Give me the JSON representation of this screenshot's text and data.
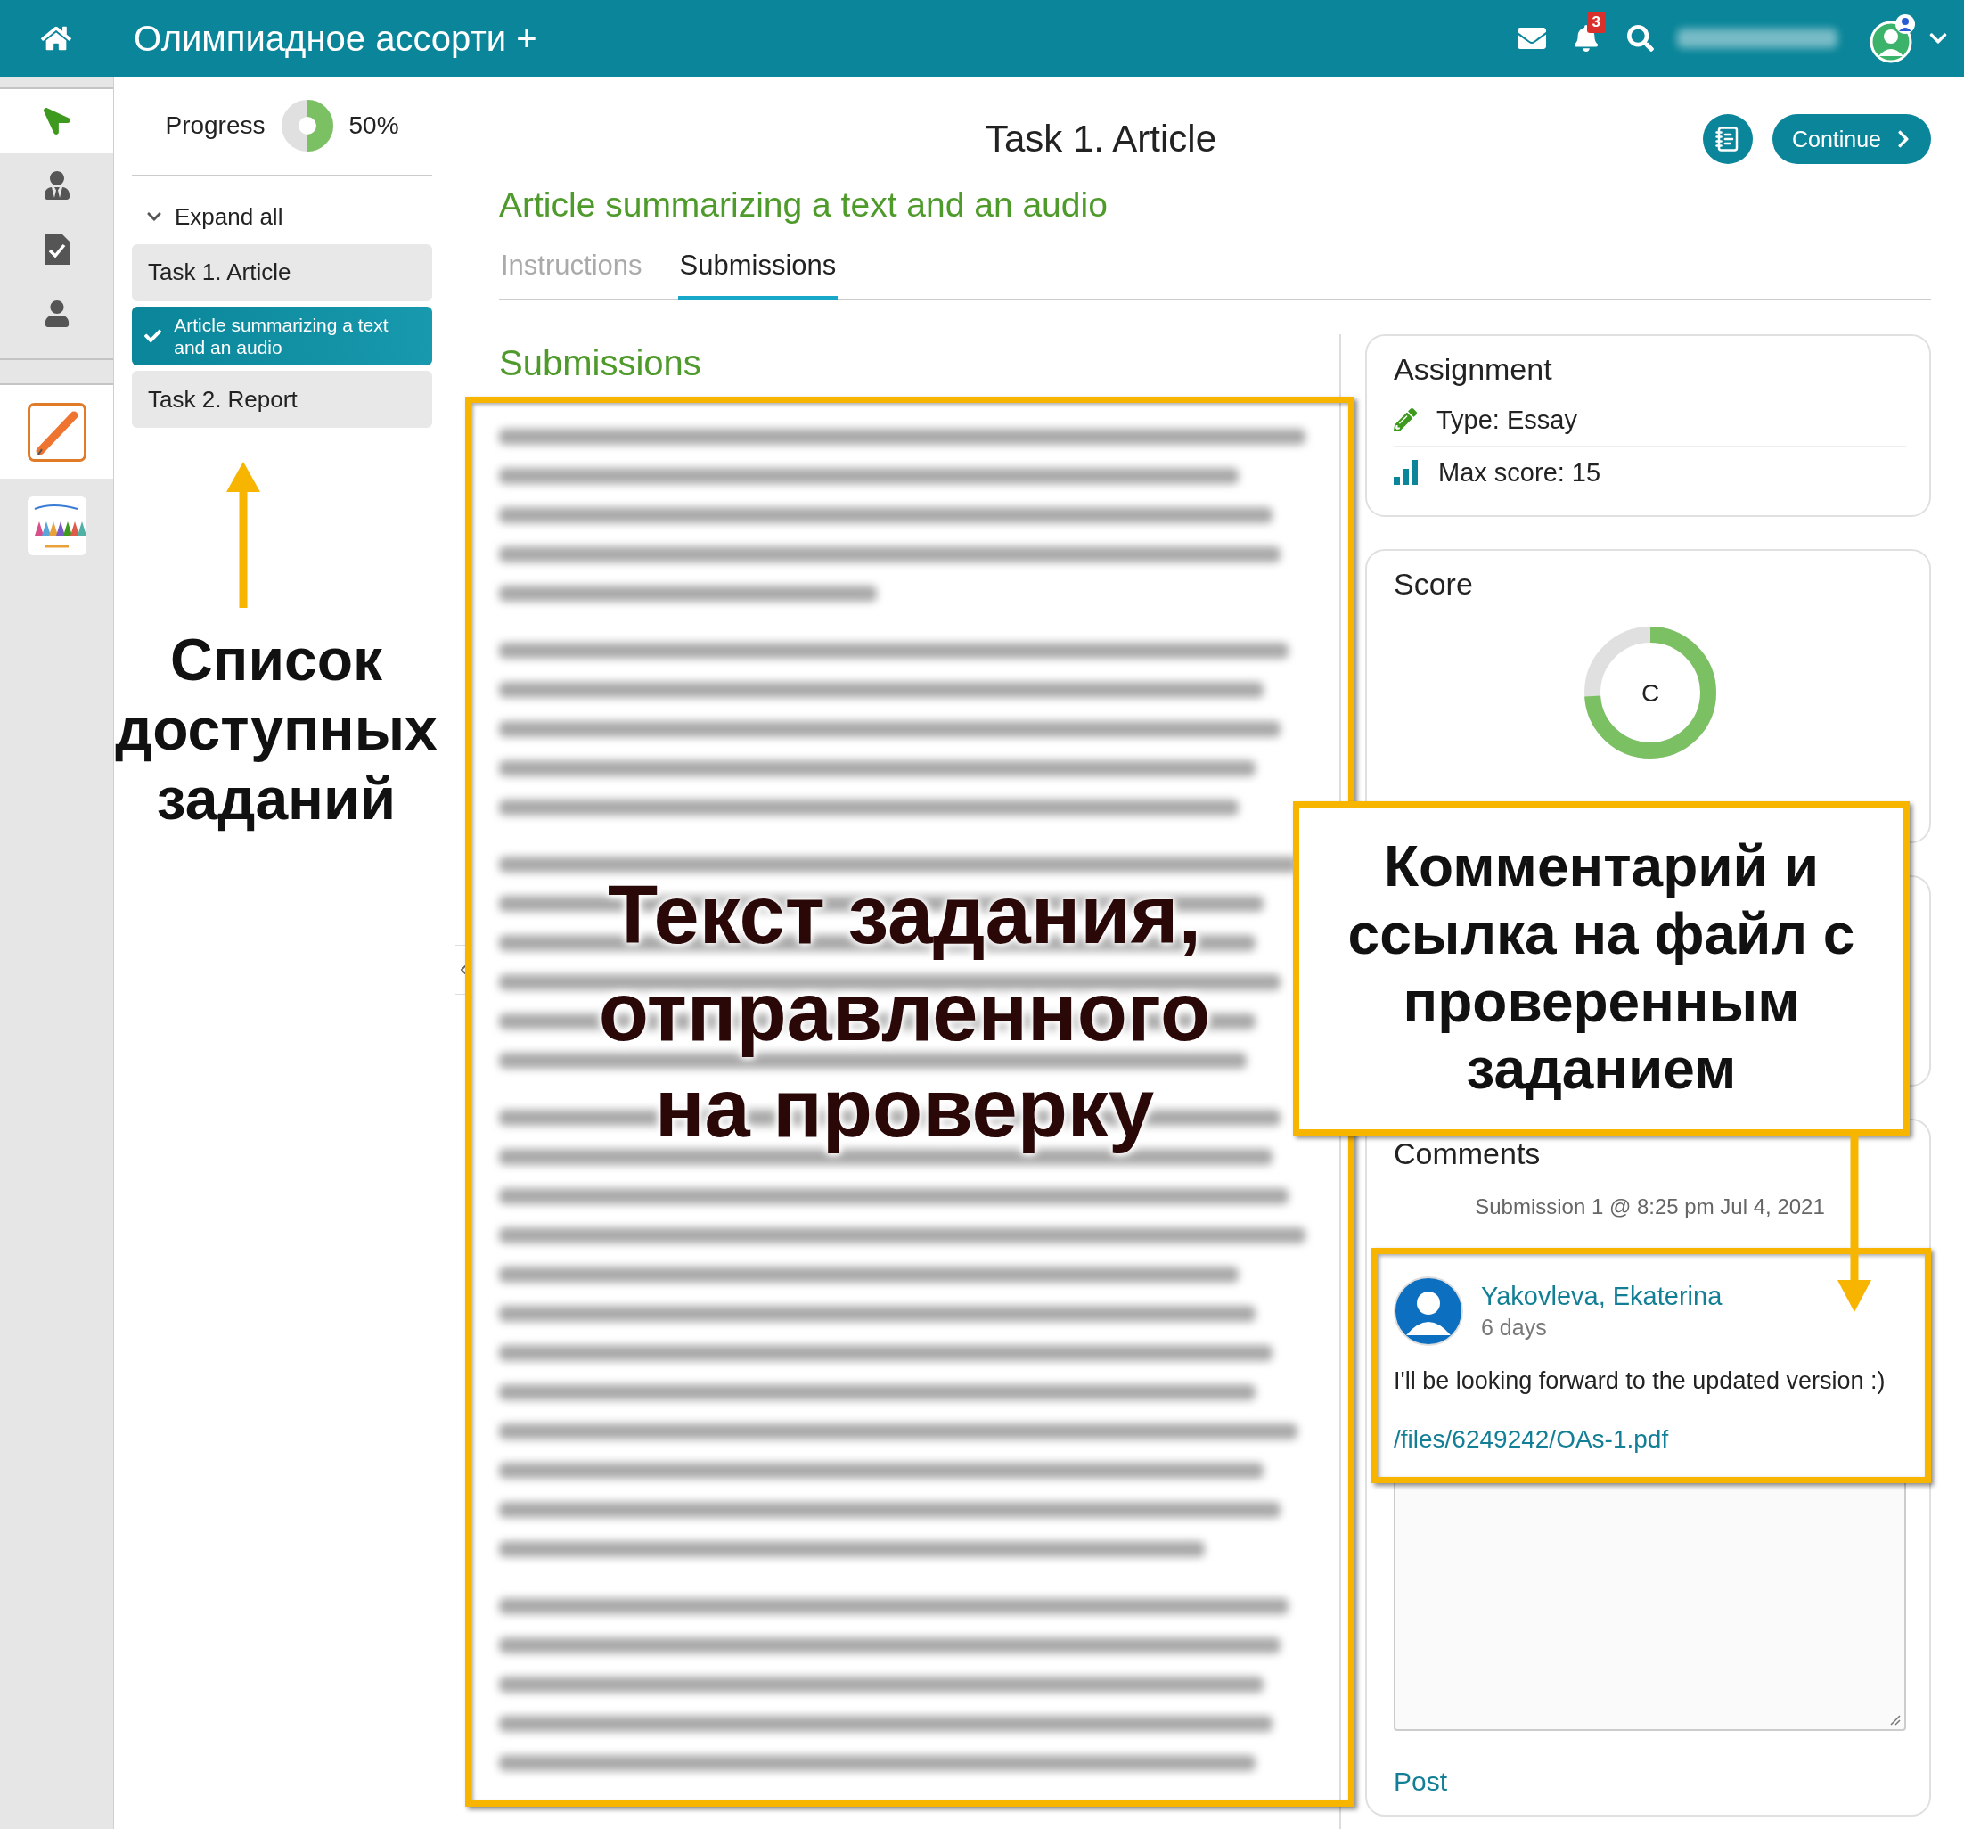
{
  "topbar": {
    "title": "Олимпиадное ассорти +",
    "notification_count": "3"
  },
  "rail": [
    {
      "kind": "navigate",
      "selected": true
    },
    {
      "kind": "teacher",
      "selected": false
    },
    {
      "kind": "grading",
      "selected": false
    },
    {
      "kind": "person",
      "selected": false
    }
  ],
  "courses": [
    {
      "kind": "pen",
      "selected": true
    },
    {
      "kind": "crowd",
      "selected": false
    }
  ],
  "progress": {
    "label": "Progress",
    "level": 0.5,
    "reading": "50%"
  },
  "expand_all": "Expand all",
  "tasks": [
    {
      "label": "Task 1. Article",
      "selected": false,
      "completed": false
    },
    {
      "label": "Article summarizing a text and an audio",
      "selected": true,
      "completed": true
    },
    {
      "label": "Task 2. Report",
      "selected": false,
      "completed": false
    }
  ],
  "header": {
    "title": "Task 1. Article",
    "continue": "Continue"
  },
  "subtitle": "Article summarizing a text and an audio",
  "tabs": [
    {
      "label": "Instructions",
      "selected": false
    },
    {
      "label": "Submissions",
      "selected": true
    }
  ],
  "submissions_heading": "Submissions",
  "assignment": {
    "title": "Assignment",
    "rows": [
      {
        "kind": "type",
        "text": "Type: Essay"
      },
      {
        "kind": "score",
        "text": "Max score: 15"
      }
    ]
  },
  "score": {
    "title": "Score",
    "level": 0.74,
    "grade": "C"
  },
  "comments": {
    "title": "Comments",
    "submission": "Submission 1 @ 8:25 pm Jul 4, 2021",
    "items": [
      {
        "author": "Yakovleva, Ekaterina",
        "age": "6 days",
        "text": "I'll be looking forward to the updated version :)",
        "link": "/files/6249242/OAs-1.pdf"
      }
    ],
    "post": "Post"
  },
  "annotations": [
    {
      "kind": "list",
      "text": "Список доступных заданий"
    },
    {
      "kind": "submission",
      "text": "Текст задания, отправленного на проверку"
    },
    {
      "kind": "comment",
      "text": "Комментарий и ссылка на файл с проверенным заданием"
    }
  ]
}
